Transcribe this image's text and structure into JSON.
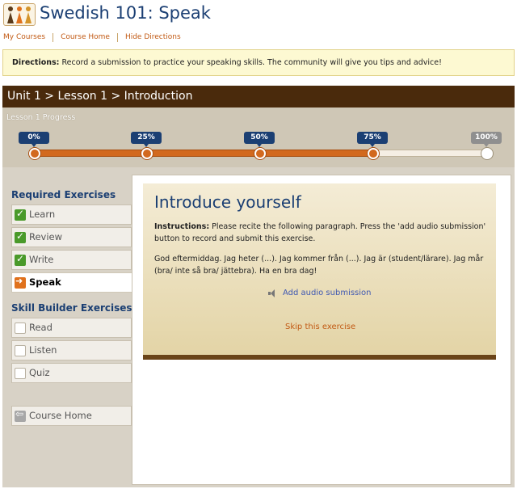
{
  "header": {
    "title": "Swedish 101: Speak",
    "logo_icon": "people-logo-icon"
  },
  "top_links": [
    "My Courses",
    "Course Home",
    "Hide Directions"
  ],
  "directions": {
    "label": "Directions:",
    "text": "Record a submission to practice your speaking skills. The community will give you tips and advice!"
  },
  "breadcrumb": "Unit 1 > Lesson 1 > Introduction",
  "progress": {
    "label": "Lesson 1 Progress",
    "markers": [
      "0%",
      "25%",
      "50%",
      "75%",
      "100%"
    ],
    "completed_fraction": 0.75
  },
  "sidebar": {
    "required_title": "Required Exercises",
    "required_items": [
      {
        "label": "Learn",
        "state": "done"
      },
      {
        "label": "Review",
        "state": "done"
      },
      {
        "label": "Write",
        "state": "done"
      },
      {
        "label": "Speak",
        "state": "current"
      }
    ],
    "skill_title": "Skill Builder Exercises",
    "skill_items": [
      {
        "label": "Read"
      },
      {
        "label": "Listen"
      },
      {
        "label": "Quiz"
      }
    ],
    "course_home": "Course Home"
  },
  "exercise": {
    "title": "Introduce yourself",
    "instructions_label": "Instructions:",
    "instructions_text": "Please recite the following paragraph. Press the 'add audio submission' button to record and submit this exercise.",
    "paragraph": "God eftermiddag. Jag heter (...). Jag kommer från (...). Jag är (student/lärare). Jag mår (bra/ inte så bra/ jättebra). Ha en bra dag!",
    "add_audio": "Add audio submission",
    "skip": "Skip this exercise"
  },
  "colors": {
    "brand_blue": "#1b3f73",
    "accent_orange": "#d2691e",
    "dark_brown": "#4a2a0c",
    "check_green": "#4a9a2a"
  }
}
